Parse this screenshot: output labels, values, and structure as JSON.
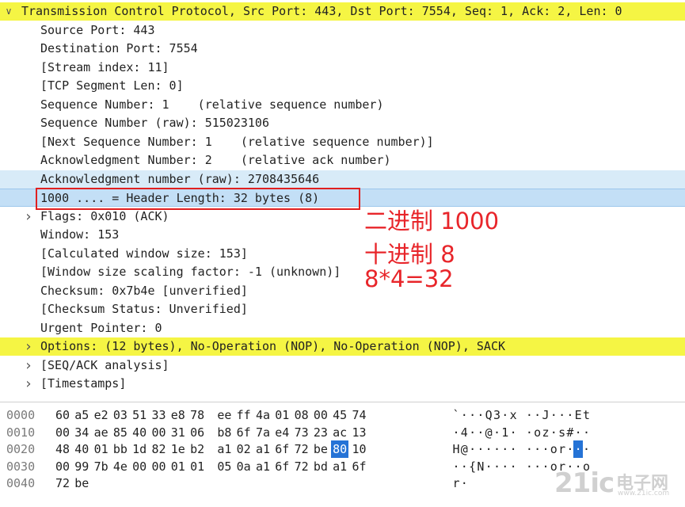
{
  "tree": [
    {
      "text": "Transmission Control Protocol, Src Port: 443, Dst Port: 7554, Seq: 1, Ack: 2, Len: 0",
      "indent": 0,
      "arrow": "expanded",
      "style": "yellow"
    },
    {
      "text": "Source Port: 443",
      "indent": 1,
      "arrow": "",
      "style": ""
    },
    {
      "text": "Destination Port: 7554",
      "indent": 1,
      "arrow": "",
      "style": ""
    },
    {
      "text": "[Stream index: 11]",
      "indent": 1,
      "arrow": "",
      "style": ""
    },
    {
      "text": "[TCP Segment Len: 0]",
      "indent": 1,
      "arrow": "",
      "style": ""
    },
    {
      "text": "Sequence Number: 1    (relative sequence number)",
      "indent": 1,
      "arrow": "",
      "style": ""
    },
    {
      "text": "Sequence Number (raw): 515023106",
      "indent": 1,
      "arrow": "",
      "style": ""
    },
    {
      "text": "[Next Sequence Number: 1    (relative sequence number)]",
      "indent": 1,
      "arrow": "",
      "style": ""
    },
    {
      "text": "Acknowledgment Number: 2    (relative ack number)",
      "indent": 1,
      "arrow": "",
      "style": ""
    },
    {
      "text": "Acknowledgment number (raw): 2708435646",
      "indent": 1,
      "arrow": "",
      "style": "sel-light"
    },
    {
      "text": "1000 .... = Header Length: 32 bytes (8)",
      "indent": 1,
      "arrow": "",
      "style": "sel"
    },
    {
      "text": "Flags: 0x010 (ACK)",
      "indent": 1,
      "arrow": "collapsed",
      "style": ""
    },
    {
      "text": "Window: 153",
      "indent": 1,
      "arrow": "",
      "style": ""
    },
    {
      "text": "[Calculated window size: 153]",
      "indent": 1,
      "arrow": "",
      "style": ""
    },
    {
      "text": "[Window size scaling factor: -1 (unknown)]",
      "indent": 1,
      "arrow": "",
      "style": ""
    },
    {
      "text": "Checksum: 0x7b4e [unverified]",
      "indent": 1,
      "arrow": "",
      "style": ""
    },
    {
      "text": "[Checksum Status: Unverified]",
      "indent": 1,
      "arrow": "",
      "style": ""
    },
    {
      "text": "Urgent Pointer: 0",
      "indent": 1,
      "arrow": "",
      "style": ""
    },
    {
      "text": "Options: (12 bytes), No-Operation (NOP), No-Operation (NOP), SACK",
      "indent": 1,
      "arrow": "collapsed",
      "style": "yellow"
    },
    {
      "text": "[SEQ/ACK analysis]",
      "indent": 1,
      "arrow": "collapsed",
      "style": ""
    },
    {
      "text": "[Timestamps]",
      "indent": 1,
      "arrow": "collapsed",
      "style": ""
    }
  ],
  "annotations": {
    "line1": "二进制 1000",
    "line2": "十进制 8",
    "line3": "8*4=32"
  },
  "hex": [
    {
      "offset": "0000",
      "bytes": [
        "60",
        "a5",
        "e2",
        "03",
        "51",
        "33",
        "e8",
        "78",
        "ee",
        "ff",
        "4a",
        "01",
        "08",
        "00",
        "45",
        "74"
      ],
      "ascii": [
        "`",
        "·",
        "·",
        "·",
        "Q",
        "3",
        "·",
        "x",
        "·",
        "·",
        "J",
        "·",
        "·",
        "·",
        "E",
        "t"
      ]
    },
    {
      "offset": "0010",
      "bytes": [
        "00",
        "34",
        "ae",
        "85",
        "40",
        "00",
        "31",
        "06",
        "b8",
        "6f",
        "7a",
        "e4",
        "73",
        "23",
        "ac",
        "13"
      ],
      "ascii": [
        "·",
        "4",
        "·",
        "·",
        "@",
        "·",
        "1",
        "·",
        "·",
        "o",
        "z",
        "·",
        "s",
        "#",
        "·",
        "·"
      ]
    },
    {
      "offset": "0020",
      "bytes": [
        "48",
        "40",
        "01",
        "bb",
        "1d",
        "82",
        "1e",
        "b2",
        "a1",
        "02",
        "a1",
        "6f",
        "72",
        "be",
        "80",
        "10"
      ],
      "ascii": [
        "H",
        "@",
        "·",
        "·",
        "·",
        "·",
        "·",
        "·",
        "·",
        "·",
        "·",
        "o",
        "r",
        "·",
        "·",
        "·"
      ]
    },
    {
      "offset": "0030",
      "bytes": [
        "00",
        "99",
        "7b",
        "4e",
        "00",
        "00",
        "01",
        "01",
        "05",
        "0a",
        "a1",
        "6f",
        "72",
        "bd",
        "a1",
        "6f"
      ],
      "ascii": [
        "·",
        "·",
        "{",
        "N",
        "·",
        "·",
        "·",
        "·",
        "·",
        "·",
        "·",
        "o",
        "r",
        "·",
        "·",
        "o"
      ]
    },
    {
      "offset": "0040",
      "bytes": [
        "72",
        "be"
      ],
      "ascii": [
        "r",
        "·"
      ]
    }
  ],
  "hex_highlight": {
    "row": 2,
    "index": 14
  },
  "watermark": {
    "big": "21ic",
    "cn": "电子网",
    "url": "www.21ic.com"
  },
  "colors": {
    "protocol_highlight": "#f5f544",
    "selection": "#c3dff6",
    "annotation": "#e8252a",
    "byte_highlight": "#2573d6"
  }
}
